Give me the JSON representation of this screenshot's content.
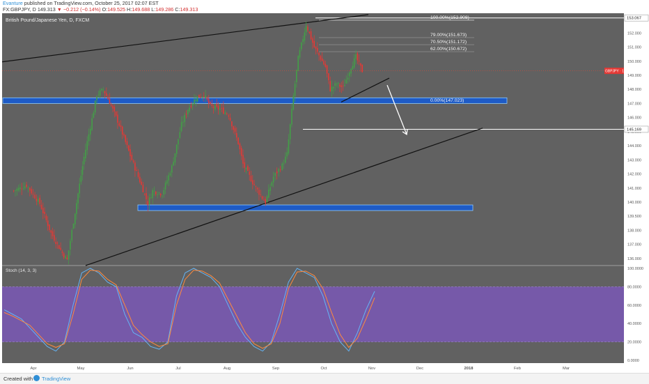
{
  "header": {
    "author": "Evanture",
    "published": "published on TradingView.com, October 25, 2017 02:07 EST",
    "ticker": "FX:GBPJPY, D",
    "last": "149.313",
    "arrow": "▼",
    "change": "−0.212 (−0.14%)",
    "o_label": "O:",
    "o_val": "149.525",
    "h_label": "H:",
    "h_val": "149.688",
    "l_label": "L:",
    "l_val": "149.286",
    "c_label": "C:",
    "c_val": "149.313"
  },
  "symbol_title": "British Pound/Japanese Yen, D, FXCM",
  "price_tag": "GBPJPY · 149.313",
  "stoch_label": "Stoch (14, 3, 3)",
  "footer": {
    "created": "Created with",
    "brand": "TradingView"
  },
  "colors": {
    "plot_bg": "#616161",
    "up": "#43a047",
    "down": "#e53935",
    "band": "#1e5bc6",
    "stoch_band": "#7e57c2",
    "k_line": "#64b5f6",
    "d_line": "#ff8a3d"
  },
  "chart_data": [
    {
      "type": "candlestick",
      "title": "British Pound/Japanese Yen, D, FXCM",
      "x_ticks": [
        "Apr",
        "May",
        "Jun",
        "Jul",
        "Aug",
        "Sep",
        "Oct",
        "Nov",
        "Dec",
        "2018",
        "Feb",
        "Mar"
      ],
      "y_ticks": [
        136.0,
        137.0,
        138.0,
        139.0,
        140.0,
        141.0,
        142.0,
        143.0,
        144.0,
        145.0,
        146.0,
        147.0,
        148.0,
        149.0,
        150.0,
        151.0,
        152.0,
        153.0
      ],
      "ylim": [
        135.5,
        153.4
      ],
      "axis_labels": [
        "136.000",
        "137.000",
        "138.000",
        "139.500",
        "140.000",
        "141.000",
        "142.000",
        "143.000",
        "144.000",
        "145.000",
        "146.000",
        "147.000",
        "148.000",
        "149.000",
        "150.000",
        "151.000",
        "152.000",
        "153.000"
      ],
      "highlight_labels": [
        {
          "text": "153.067",
          "value": 153.067
        },
        {
          "text": "145.169",
          "value": 145.169
        },
        {
          "text": "GBPJPY · 149.313",
          "value": 149.313
        }
      ],
      "close_path": [
        [
          "Mar 20",
          140.8
        ],
        [
          "Mar 28",
          141.2
        ],
        [
          "Apr 5",
          139.9
        ],
        [
          "Apr 12",
          137.8
        ],
        [
          "Apr 19",
          136.4
        ],
        [
          "Apr 22",
          135.9
        ],
        [
          "Apr 27",
          139.3
        ],
        [
          "May 3",
          143.2
        ],
        [
          "May 8",
          145.9
        ],
        [
          "May 11",
          147.6
        ],
        [
          "May 15",
          148.0
        ],
        [
          "May 19",
          147.1
        ],
        [
          "May 25",
          145.5
        ],
        [
          "Jun 1",
          143.3
        ],
        [
          "Jun 8",
          141.2
        ],
        [
          "Jun 12",
          139.9
        ],
        [
          "Jun 15",
          140.8
        ],
        [
          "Jun 21",
          140.6
        ],
        [
          "Jun 27",
          142.5
        ],
        [
          "Jul 3",
          145.5
        ],
        [
          "Jul 7",
          146.6
        ],
        [
          "Jul 12",
          147.4
        ],
        [
          "Jul 17",
          147.6
        ],
        [
          "Jul 21",
          146.8
        ],
        [
          "Jul 27",
          146.6
        ],
        [
          "Aug 2",
          146.2
        ],
        [
          "Aug 8",
          144.2
        ],
        [
          "Aug 11",
          142.7
        ],
        [
          "Aug 17",
          141.4
        ],
        [
          "Aug 23",
          140.3
        ],
        [
          "Aug 25",
          140.0
        ],
        [
          "Aug 30",
          141.8
        ],
        [
          "Sep 5",
          142.6
        ],
        [
          "Sep 8",
          143.4
        ],
        [
          "Sep 12",
          147.5
        ],
        [
          "Sep 15",
          150.2
        ],
        [
          "Sep 20",
          152.6
        ],
        [
          "Sep 25",
          151.0
        ],
        [
          "Oct 2",
          149.6
        ],
        [
          "Oct 5",
          148.0
        ],
        [
          "Oct 9",
          148.4
        ],
        [
          "Oct 13",
          148.1
        ],
        [
          "Oct 18",
          149.6
        ],
        [
          "Oct 21",
          150.3
        ],
        [
          "Oct 25",
          149.3
        ]
      ],
      "fibonacci": [
        {
          "label": "100.00%(152.908)",
          "value": 152.908
        },
        {
          "label": "79.00%(151.673)",
          "value": 151.673
        },
        {
          "label": "70.50%(151.172)",
          "value": 151.172
        },
        {
          "label": "62.00%(150.672)",
          "value": 150.672
        },
        {
          "label": "0.00%(147.023)",
          "value": 147.023
        }
      ],
      "horizontal_levels": [
        153.067,
        145.169
      ],
      "zones": [
        {
          "from": 147.0,
          "to": 147.4
        },
        {
          "from": 139.4,
          "to": 139.8
        }
      ]
    },
    {
      "type": "line",
      "title": "Stoch (14, 3, 3)",
      "y_ticks": [
        "100.0000",
        "80.0000",
        "60.0000",
        "40.0000",
        "20.0000",
        "0.0000"
      ],
      "ylim": [
        0,
        100
      ],
      "band": [
        20,
        80
      ],
      "series": [
        {
          "name": "%K",
          "values": [
            55,
            50,
            45,
            35,
            25,
            15,
            10,
            20,
            60,
            95,
            100,
            95,
            85,
            80,
            50,
            30,
            25,
            15,
            12,
            20,
            70,
            95,
            100,
            95,
            90,
            80,
            60,
            40,
            25,
            15,
            10,
            20,
            50,
            85,
            100,
            95,
            90,
            70,
            40,
            20,
            10,
            30,
            55,
            75
          ]
        },
        {
          "name": "%D",
          "values": [
            52,
            48,
            43,
            38,
            28,
            18,
            14,
            18,
            50,
            88,
            98,
            97,
            88,
            82,
            60,
            38,
            28,
            20,
            15,
            18,
            60,
            88,
            98,
            97,
            92,
            84,
            66,
            48,
            30,
            18,
            13,
            18,
            40,
            78,
            96,
            97,
            92,
            78,
            52,
            28,
            14,
            24,
            45,
            68
          ]
        }
      ]
    }
  ]
}
